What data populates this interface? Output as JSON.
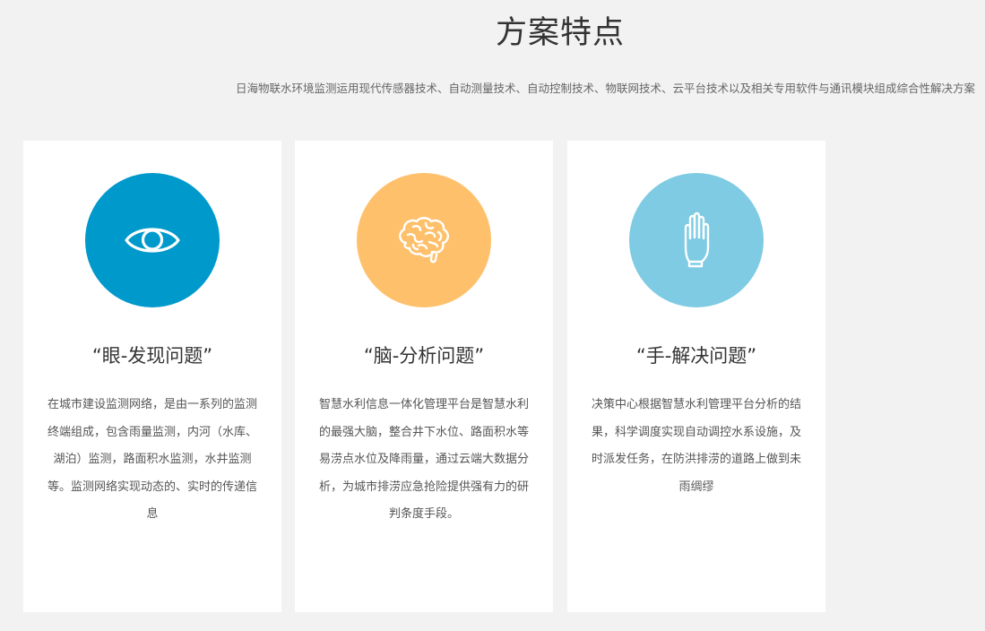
{
  "section": {
    "title": "方案特点",
    "subtitle": "日海物联水环境监测运用现代传感器技术、自动测量技术、自动控制技术、物联网技术、云平台技术以及相关专用软件与通讯模块组成综合性解决方案"
  },
  "cards": [
    {
      "icon": "eye-icon",
      "color": "#0099cc",
      "title": "“眼-发现问题”",
      "text": "在城市建设监测网络，是由一系列的监测终端组成，包含雨量监测，内河（水库、湖泊）监测，路面积水监测，水井监测等。监测网络实现动态的、实时的传递信息"
    },
    {
      "icon": "brain-icon",
      "color": "#ffc06b",
      "title": "“脑-分析问题”",
      "text": "智慧水利信息一体化管理平台是智慧水利的最强大脑，整合井下水位、路面积水等易涝点水位及降雨量，通过云端大数据分析，为城市排涝应急抢险提供强有力的研判条度手段。"
    },
    {
      "icon": "hand-icon",
      "color": "#7ecbe3",
      "title": "“手-解决问题”",
      "text": "决策中心根据智慧水利管理平台分析的结果，科学调度实现自动调控水系设施，及时派发任务，在防洪排涝的道路上做到未雨绸缪"
    }
  ]
}
